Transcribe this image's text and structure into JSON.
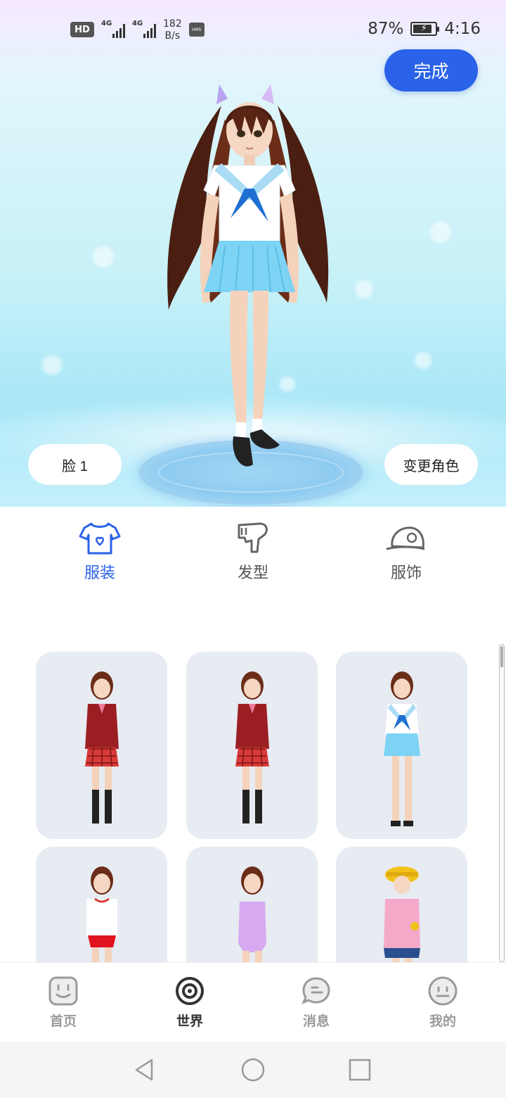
{
  "status_bar": {
    "hd": "HD",
    "sim1": "4G",
    "sim2": "4G",
    "speed_value": "182",
    "speed_unit": "B/s",
    "battery": "87%",
    "time": "4:16"
  },
  "stage": {
    "done_label": "完成",
    "face_label": "脸 1",
    "change_role_label": "变更角色"
  },
  "categories": [
    {
      "label": "服装",
      "icon": "tshirt-icon",
      "active": true
    },
    {
      "label": "发型",
      "icon": "hairdryer-icon",
      "active": false
    },
    {
      "label": "服饰",
      "icon": "cap-icon",
      "active": false
    }
  ],
  "outfits": [
    {
      "name": "red-blazer-plaid-skirt"
    },
    {
      "name": "red-blazer-plaid-skirt-2"
    },
    {
      "name": "sailor-uniform-blue"
    },
    {
      "name": "gym-uniform-red"
    },
    {
      "name": "purple-swimsuit"
    },
    {
      "name": "pink-kindergarten-yellow-hat"
    }
  ],
  "bottom_nav": [
    {
      "label": "首页",
      "icon": "home-icon",
      "active": false
    },
    {
      "label": "世界",
      "icon": "world-icon",
      "active": true
    },
    {
      "label": "消息",
      "icon": "message-icon",
      "active": false
    },
    {
      "label": "我的",
      "icon": "profile-icon",
      "active": false
    }
  ],
  "colors": {
    "accent": "#2a63e9",
    "card_bg": "#e7ebf2",
    "inactive": "#9a9a9a"
  }
}
